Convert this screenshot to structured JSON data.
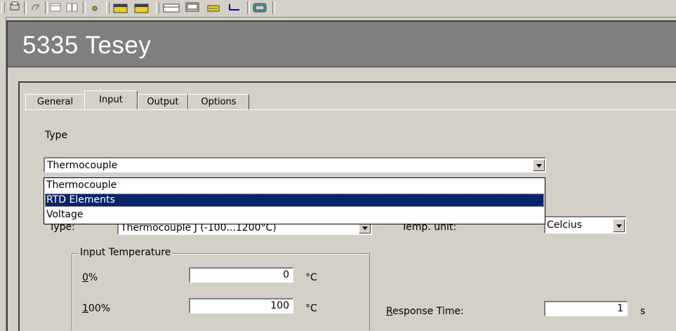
{
  "window": {
    "title": "5335 Tesey"
  },
  "tabs": [
    {
      "label": "General"
    },
    {
      "label": "Input"
    },
    {
      "label": "Output"
    },
    {
      "label": "Options"
    }
  ],
  "type_section": {
    "label": "Type",
    "selected": "Thermocouple",
    "options": [
      "Thermocouple",
      "RTD Elements",
      "Voltage"
    ],
    "highlighted_index": 1
  },
  "sensor": {
    "label_hidden": "Type:",
    "value_partial": "Thermocouple J  (-100...1200°C)"
  },
  "temp_unit": {
    "label": "Temp. unit:",
    "value": "Celcius"
  },
  "input_temperature": {
    "group_label": "Input Temperature",
    "zero": {
      "label_prefix": "0",
      "label_suffix": "%",
      "value": "0",
      "unit": "°C"
    },
    "hundred": {
      "label_prefix": "1",
      "label_suffix": "00%",
      "value": "100",
      "unit": "°C"
    }
  },
  "response_time": {
    "label_prefix": "R",
    "label_suffix": "esponse Time:",
    "value": "1",
    "unit": "s"
  },
  "colors": {
    "banner": "#7f7f7f",
    "selection": "#0a246a",
    "face": "#d4d0c8"
  }
}
